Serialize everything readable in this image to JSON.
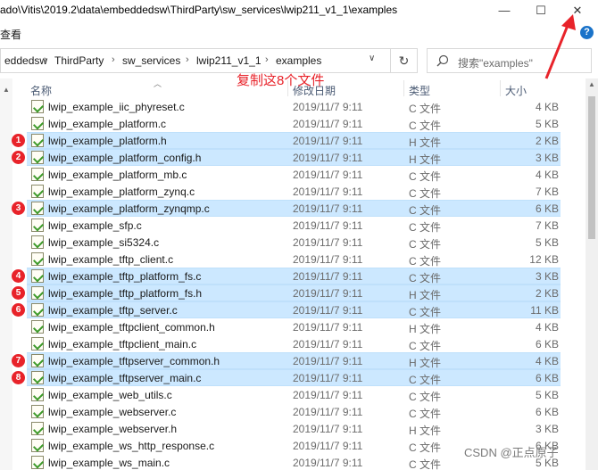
{
  "window": {
    "title": "ado\\Vitis\\2019.2\\data\\embeddedsw\\ThirdParty\\sw_services\\lwip211_v1_1\\examples",
    "menu_label": "查看",
    "minimize": "—",
    "maximize": "☐",
    "close": "✕",
    "help": "?"
  },
  "address": {
    "crumbs": [
      "eddedsw",
      "ThirdParty",
      "sw_services",
      "lwip211_v1_1",
      "examples"
    ],
    "separator": "›",
    "dropdown": "∨",
    "refresh": "↻"
  },
  "search": {
    "placeholder": "搜索\"examples\""
  },
  "annotation": "复制这8个文件",
  "columns": {
    "name": "名称",
    "date": "修改日期",
    "type": "类型",
    "size": "大小"
  },
  "files": [
    {
      "name": "lwip_example_iic_phyreset.c",
      "date": "2019/11/7 9:11",
      "type": "C 文件",
      "size": "4 KB",
      "selected": false,
      "badge": ""
    },
    {
      "name": "lwip_example_platform.c",
      "date": "2019/11/7 9:11",
      "type": "C 文件",
      "size": "5 KB",
      "selected": false,
      "badge": ""
    },
    {
      "name": "lwip_example_platform.h",
      "date": "2019/11/7 9:11",
      "type": "H 文件",
      "size": "2 KB",
      "selected": true,
      "badge": "1"
    },
    {
      "name": "lwip_example_platform_config.h",
      "date": "2019/11/7 9:11",
      "type": "H 文件",
      "size": "3 KB",
      "selected": true,
      "badge": "2"
    },
    {
      "name": "lwip_example_platform_mb.c",
      "date": "2019/11/7 9:11",
      "type": "C 文件",
      "size": "4 KB",
      "selected": false,
      "badge": ""
    },
    {
      "name": "lwip_example_platform_zynq.c",
      "date": "2019/11/7 9:11",
      "type": "C 文件",
      "size": "7 KB",
      "selected": false,
      "badge": ""
    },
    {
      "name": "lwip_example_platform_zynqmp.c",
      "date": "2019/11/7 9:11",
      "type": "C 文件",
      "size": "6 KB",
      "selected": true,
      "badge": "3"
    },
    {
      "name": "lwip_example_sfp.c",
      "date": "2019/11/7 9:11",
      "type": "C 文件",
      "size": "7 KB",
      "selected": false,
      "badge": ""
    },
    {
      "name": "lwip_example_si5324.c",
      "date": "2019/11/7 9:11",
      "type": "C 文件",
      "size": "5 KB",
      "selected": false,
      "badge": ""
    },
    {
      "name": "lwip_example_tftp_client.c",
      "date": "2019/11/7 9:11",
      "type": "C 文件",
      "size": "12 KB",
      "selected": false,
      "badge": ""
    },
    {
      "name": "lwip_example_tftp_platform_fs.c",
      "date": "2019/11/7 9:11",
      "type": "C 文件",
      "size": "3 KB",
      "selected": true,
      "badge": "4"
    },
    {
      "name": "lwip_example_tftp_platform_fs.h",
      "date": "2019/11/7 9:11",
      "type": "H 文件",
      "size": "2 KB",
      "selected": true,
      "badge": "5"
    },
    {
      "name": "lwip_example_tftp_server.c",
      "date": "2019/11/7 9:11",
      "type": "C 文件",
      "size": "11 KB",
      "selected": true,
      "badge": "6"
    },
    {
      "name": "lwip_example_tftpclient_common.h",
      "date": "2019/11/7 9:11",
      "type": "H 文件",
      "size": "4 KB",
      "selected": false,
      "badge": ""
    },
    {
      "name": "lwip_example_tftpclient_main.c",
      "date": "2019/11/7 9:11",
      "type": "C 文件",
      "size": "6 KB",
      "selected": false,
      "badge": ""
    },
    {
      "name": "lwip_example_tftpserver_common.h",
      "date": "2019/11/7 9:11",
      "type": "H 文件",
      "size": "4 KB",
      "selected": true,
      "badge": "7"
    },
    {
      "name": "lwip_example_tftpserver_main.c",
      "date": "2019/11/7 9:11",
      "type": "C 文件",
      "size": "6 KB",
      "selected": true,
      "badge": "8"
    },
    {
      "name": "lwip_example_web_utils.c",
      "date": "2019/11/7 9:11",
      "type": "C 文件",
      "size": "5 KB",
      "selected": false,
      "badge": ""
    },
    {
      "name": "lwip_example_webserver.c",
      "date": "2019/11/7 9:11",
      "type": "C 文件",
      "size": "6 KB",
      "selected": false,
      "badge": ""
    },
    {
      "name": "lwip_example_webserver.h",
      "date": "2019/11/7 9:11",
      "type": "H 文件",
      "size": "3 KB",
      "selected": false,
      "badge": ""
    },
    {
      "name": "lwip_example_ws_http_response.c",
      "date": "2019/11/7 9:11",
      "type": "C 文件",
      "size": "6 KB",
      "selected": false,
      "badge": ""
    },
    {
      "name": "lwip_example_ws_main.c",
      "date": "2019/11/7 9:11",
      "type": "C 文件",
      "size": "5 KB",
      "selected": false,
      "badge": ""
    }
  ],
  "watermark": "CSDN @正点原子",
  "colors": {
    "selection": "#cce8ff",
    "badge": "#e8232a",
    "annotation": "#e8232a"
  }
}
